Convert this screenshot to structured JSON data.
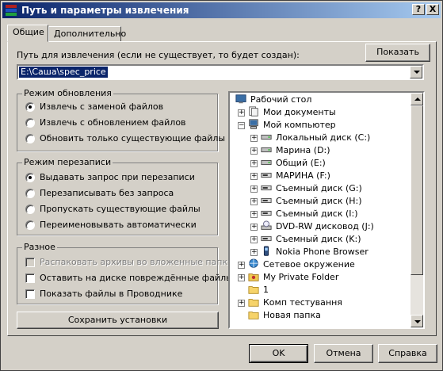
{
  "window": {
    "title": "Путь и параметры извлечения",
    "help_btn": "?",
    "close_btn": "X"
  },
  "tabs": [
    "Общие",
    "Дополнительно"
  ],
  "path": {
    "label": "Путь для извлечения (если не существует, то будет создан):",
    "value": "E:\\Саша\\spec_price",
    "show_button": "Показать"
  },
  "update_mode": {
    "title": "Режим обновления",
    "options": [
      {
        "label": "Извлечь с заменой файлов",
        "selected": true
      },
      {
        "label": "Извлечь с обновлением файлов",
        "selected": false
      },
      {
        "label": "Обновить только существующие файлы",
        "selected": false
      }
    ]
  },
  "overwrite_mode": {
    "title": "Режим перезаписи",
    "options": [
      {
        "label": "Выдавать запрос при перезаписи",
        "selected": true
      },
      {
        "label": "Перезаписывать без запроса",
        "selected": false
      },
      {
        "label": "Пропускать существующие файлы",
        "selected": false
      },
      {
        "label": "Переименовывать автоматически",
        "selected": false
      }
    ]
  },
  "misc": {
    "title": "Разное",
    "options": [
      {
        "label": "Распаковать архивы во вложенные папки",
        "checked": false,
        "disabled": true
      },
      {
        "label": "Оставить на диске повреждённые файлы",
        "checked": false,
        "disabled": false
      },
      {
        "label": "Показать файлы в Проводнике",
        "checked": false,
        "disabled": false
      }
    ]
  },
  "save_settings_button": "Сохранить установки",
  "tree": {
    "items": [
      {
        "label": "Рабочий стол",
        "level": 0,
        "expander": "",
        "icon": "desktop-icon"
      },
      {
        "label": "Мои документы",
        "level": 1,
        "expander": "+",
        "icon": "documents-icon"
      },
      {
        "label": "Мой компьютер",
        "level": 1,
        "expander": "-",
        "icon": "computer-icon"
      },
      {
        "label": "Локальный диск (C:)",
        "level": 2,
        "expander": "+",
        "icon": "hard-drive-icon"
      },
      {
        "label": "Марина (D:)",
        "level": 2,
        "expander": "+",
        "icon": "hard-drive-icon"
      },
      {
        "label": "Общий (E:)",
        "level": 2,
        "expander": "+",
        "icon": "hard-drive-icon"
      },
      {
        "label": "МАРИНА (F:)",
        "level": 2,
        "expander": "+",
        "icon": "removable-drive-icon"
      },
      {
        "label": "Съемный диск (G:)",
        "level": 2,
        "expander": "+",
        "icon": "removable-drive-icon"
      },
      {
        "label": "Съемный диск (H:)",
        "level": 2,
        "expander": "+",
        "icon": "removable-drive-icon"
      },
      {
        "label": "Съемный диск (I:)",
        "level": 2,
        "expander": "+",
        "icon": "removable-drive-icon"
      },
      {
        "label": "DVD-RW дисковод (J:)",
        "level": 2,
        "expander": "+",
        "icon": "dvd-drive-icon"
      },
      {
        "label": "Съемный диск (K:)",
        "level": 2,
        "expander": "+",
        "icon": "removable-drive-icon"
      },
      {
        "label": "Nokia Phone Browser",
        "level": 2,
        "expander": "+",
        "icon": "phone-icon"
      },
      {
        "label": "Сетевое окружение",
        "level": 1,
        "expander": "+",
        "icon": "network-icon"
      },
      {
        "label": "My Private Folder",
        "level": 1,
        "expander": "+",
        "icon": "private-folder-icon"
      },
      {
        "label": "1",
        "level": 1,
        "expander": "",
        "icon": "folder-icon"
      },
      {
        "label": "Комп тестування",
        "level": 1,
        "expander": "+",
        "icon": "folder-icon"
      },
      {
        "label": "Новая папка",
        "level": 1,
        "expander": "",
        "icon": "folder-icon"
      }
    ]
  },
  "footer": {
    "ok": "OK",
    "cancel": "Отмена",
    "help": "Справка"
  }
}
